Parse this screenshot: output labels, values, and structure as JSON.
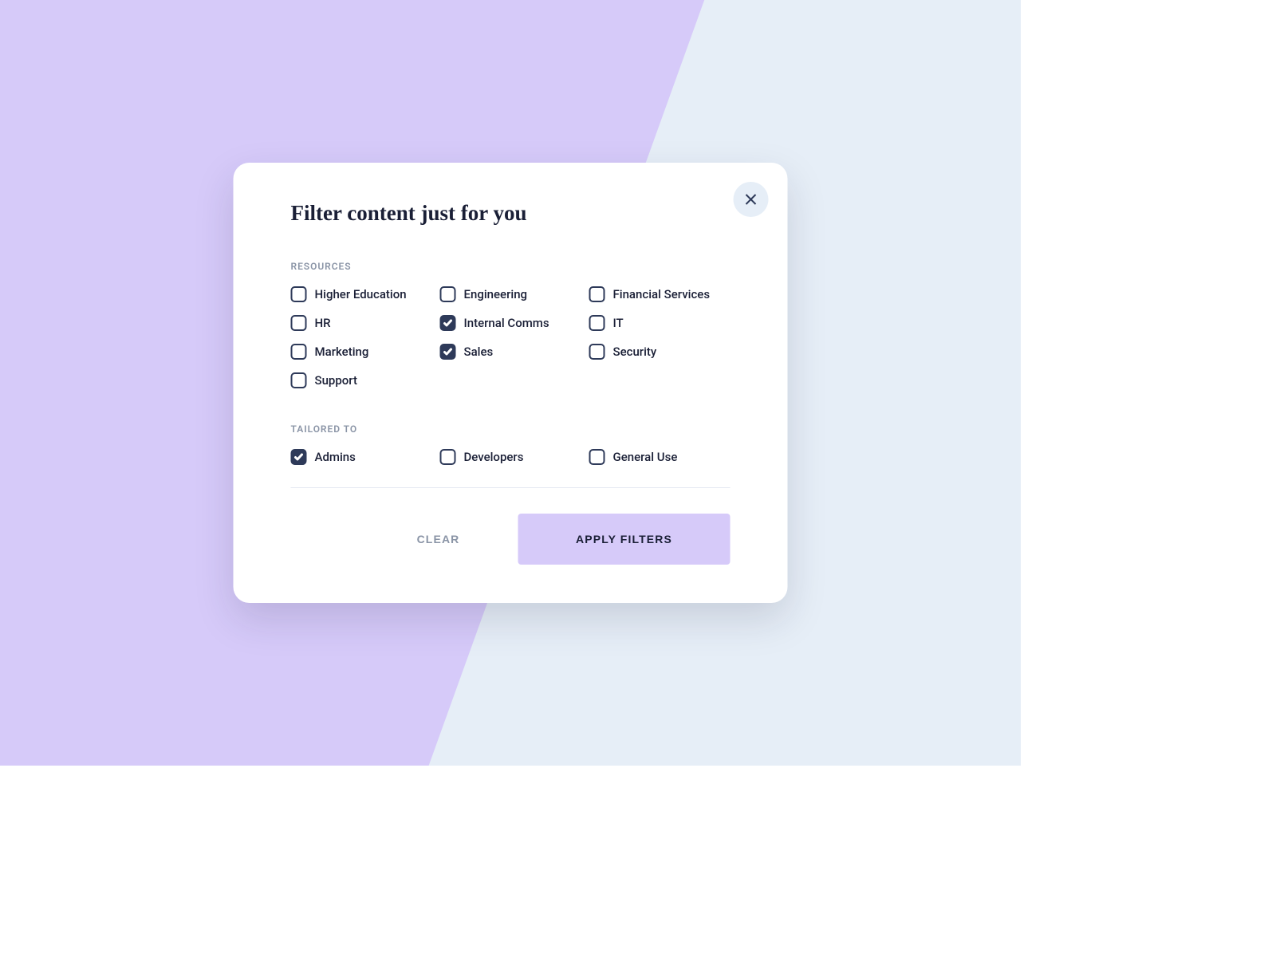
{
  "modal": {
    "title": "Filter content just for you",
    "sections": {
      "resources": {
        "label": "RESOURCES",
        "items": [
          {
            "label": "Higher Education",
            "checked": false
          },
          {
            "label": "Engineering",
            "checked": false
          },
          {
            "label": "Financial Services",
            "checked": false
          },
          {
            "label": "HR",
            "checked": false
          },
          {
            "label": "Internal Comms",
            "checked": true
          },
          {
            "label": "IT",
            "checked": false
          },
          {
            "label": "Marketing",
            "checked": false
          },
          {
            "label": "Sales",
            "checked": true
          },
          {
            "label": "Security",
            "checked": false
          },
          {
            "label": "Support",
            "checked": false
          }
        ]
      },
      "tailored": {
        "label": "TAILORED TO",
        "items": [
          {
            "label": "Admins",
            "checked": true
          },
          {
            "label": "Developers",
            "checked": false
          },
          {
            "label": "General Use",
            "checked": false
          }
        ]
      }
    },
    "buttons": {
      "clear": "CLEAR",
      "apply": "APPLY FILTERS"
    }
  }
}
